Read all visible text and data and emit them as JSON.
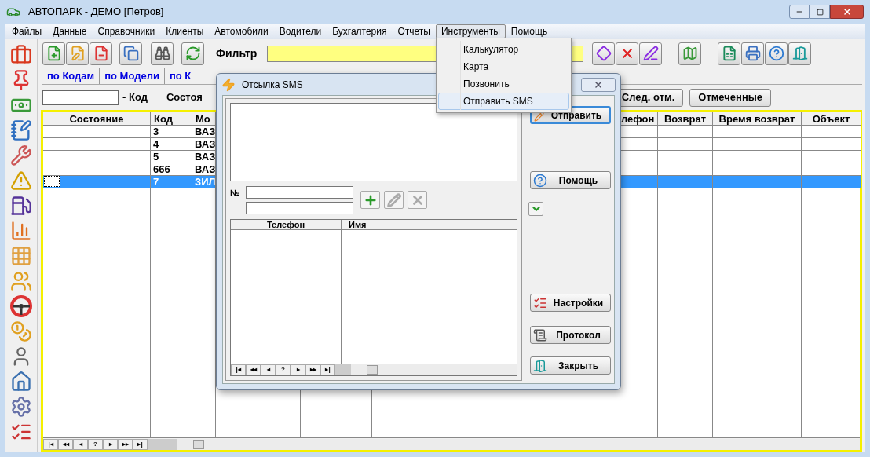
{
  "window": {
    "title": "АВТОПАРК - ДЕМО [Петров]"
  },
  "menu": [
    {
      "label": "Файлы",
      "selected": false
    },
    {
      "label": "Данные",
      "selected": false
    },
    {
      "label": "Справочники",
      "selected": false
    },
    {
      "label": "Клиенты",
      "selected": false
    },
    {
      "label": "Автомобили",
      "selected": false
    },
    {
      "label": "Водители",
      "selected": false
    },
    {
      "label": "Бухгалтерия",
      "selected": false
    },
    {
      "label": "Отчеты",
      "selected": false
    },
    {
      "label": "Инструменты",
      "selected": true
    },
    {
      "label": "Помощь",
      "selected": false
    }
  ],
  "dropdown": [
    {
      "label": "Калькулятор",
      "selected": false
    },
    {
      "label": "Карта",
      "selected": false
    },
    {
      "label": "Позвонить",
      "selected": false
    },
    {
      "label": "Отправить SMS",
      "selected": true
    }
  ],
  "toolbar": {
    "filter_label": "Фильтр"
  },
  "tabs": [
    {
      "label": "по Кодам",
      "selected": false
    },
    {
      "label": "по Модели",
      "selected": false
    },
    {
      "label": "по К",
      "selected": false
    }
  ],
  "filter_row": {
    "code_label": "- Код",
    "state_label": "Состоя",
    "buttons": [
      "След. отм.",
      "Отмеченные"
    ]
  },
  "table": {
    "columns": [
      "Состояние",
      "Код",
      "Мо",
      "лефон",
      "Возврат",
      "Время возврат",
      "Объект"
    ],
    "rows": [
      {
        "cells": [
          "",
          "3",
          "ВАЗ"
        ],
        "selected": false
      },
      {
        "cells": [
          "",
          "4",
          "ВАЗ"
        ],
        "selected": false
      },
      {
        "cells": [
          "",
          "5",
          "ВАЗ"
        ],
        "selected": false
      },
      {
        "cells": [
          "",
          "666",
          "ВАЗ"
        ],
        "selected": false
      },
      {
        "cells": [
          "",
          "7",
          "ЗИЛ"
        ],
        "selected": true
      }
    ]
  },
  "navigator": [
    "|◂",
    "◂◂",
    "◂",
    "?",
    "▸",
    "▸▸",
    "▸|"
  ],
  "dialog": {
    "title": "Отсылка SMS",
    "number_label": "№",
    "list_columns": [
      "Телефон",
      "Имя"
    ],
    "navigator": [
      "|◂",
      "◂◂",
      "◂",
      "?",
      "▸",
      "▸▸",
      "▸|"
    ],
    "buttons": [
      {
        "label": "Отправить",
        "kind": "send"
      },
      {
        "label": "Помощь",
        "kind": "help"
      },
      {
        "label": "Настройки",
        "kind": "settings"
      },
      {
        "label": "Протокол",
        "kind": "log"
      },
      {
        "label": "Закрыть",
        "kind": "close"
      }
    ]
  }
}
